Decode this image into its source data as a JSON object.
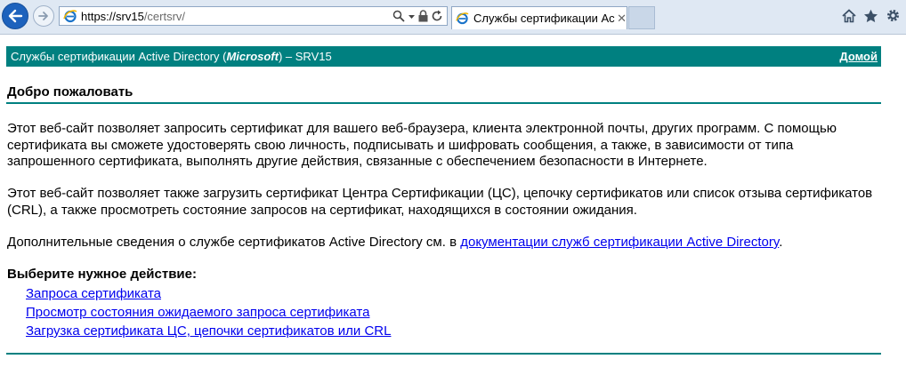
{
  "browser": {
    "url_host": "https://srv15",
    "url_path": "/certsrv/",
    "tab_title": "Службы сертификации Ac...",
    "tab_close": "✕"
  },
  "header": {
    "title_prefix": "Службы сертификации Active Directory (",
    "title_brand": "Microsoft",
    "title_suffix": ")  –  SRV15",
    "home_link": "Домой"
  },
  "main": {
    "welcome": "Добро пожаловать",
    "paragraph1": "Этот веб-сайт позволяет запросить сертификат для вашего веб-браузера, клиента электронной почты, других программ. С помощью сертификата вы сможете удостоверять свою личность, подписывать и шифровать сообщения, а также, в зависимости от типа запрошенного сертификата, выполнять другие действия, связанные с обеспечением безопасности в Интернете.",
    "paragraph2": "Этот веб-сайт позволяет также загрузить сертификат Центра Сертификации (ЦС), цепочку сертификатов или список отзыва сертификатов (CRL), а также просмотреть состояние запросов на сертификат, находящихся в состоянии ожидания.",
    "paragraph3_prefix": "Дополнительные сведения о службе сертификатов Active Directory см. в ",
    "paragraph3_link": "документации служб сертификации Active Directory",
    "paragraph3_suffix": ".",
    "choose_action": "Выберите нужное действие:",
    "actions": [
      "Запроса сертификата",
      "Просмотр состояния ожидаемого запроса сертификата",
      "Загрузка сертификата ЦС, цепочки сертификатов или CRL"
    ]
  },
  "colors": {
    "accent": "#008080",
    "link": "#0000ee",
    "chrome_bg": "#dfe8f3"
  }
}
